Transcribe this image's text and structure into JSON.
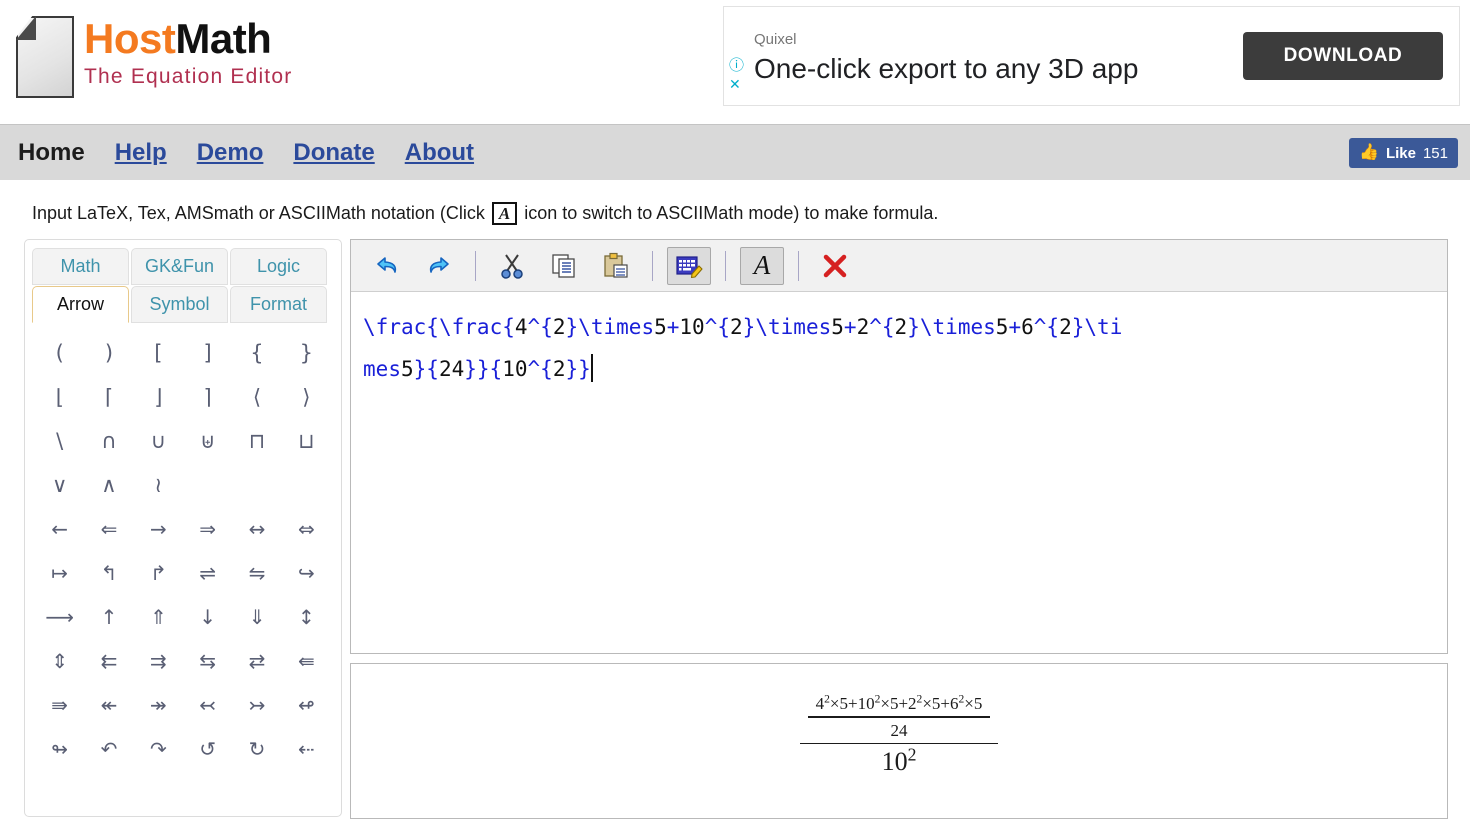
{
  "site": {
    "logo_primary": "Host",
    "logo_secondary": "Math",
    "tagline": "The Equation Editor",
    "colors": {
      "orange": "#f47a20",
      "black": "#111111",
      "maroon": "#b03050",
      "link": "#2b4a9b",
      "fb_blue": "#3b5998"
    }
  },
  "ad": {
    "brand": "Quixel",
    "headline": "One-click export to any 3D app",
    "cta_label": "DOWNLOAD",
    "info_icon": "info-icon",
    "close_icon": "close-icon"
  },
  "nav": {
    "items": [
      {
        "label": "Home",
        "current": true
      },
      {
        "label": "Help",
        "current": false
      },
      {
        "label": "Demo",
        "current": false
      },
      {
        "label": "Donate",
        "current": false
      },
      {
        "label": "About",
        "current": false
      }
    ],
    "like": {
      "label": "Like",
      "count": "151",
      "icon": "thumbs-up-icon"
    }
  },
  "instruction": {
    "before": "Input LaTeX, Tex, AMSmath or ASCIIMath notation (Click",
    "icon_letter": "A",
    "after": "icon to switch to ASCIIMath mode) to make formula."
  },
  "symbol_panel": {
    "tabs": [
      {
        "label": "Math",
        "active": false
      },
      {
        "label": "GK&Fun",
        "active": false
      },
      {
        "label": "Logic",
        "active": false
      },
      {
        "label": "Arrow",
        "active": true
      },
      {
        "label": "Symbol",
        "active": false
      },
      {
        "label": "Format",
        "active": false
      }
    ],
    "symbols": [
      "(",
      ")",
      "[",
      "]",
      "{",
      "}",
      "⌊",
      "⌈",
      "⌋",
      "⌉",
      "⟨",
      "⟩",
      "\\",
      "∩",
      "∪",
      "⊎",
      "⊓",
      "⊔",
      "∨",
      "∧",
      "≀",
      "",
      "",
      "",
      "←",
      "⇐",
      "→",
      "⇒",
      "↔",
      "⇔",
      "↦",
      "↰",
      "↱",
      "⇌",
      "⇋",
      "↪",
      "⟶",
      "↑",
      "⇑",
      "↓",
      "⇓",
      "↕",
      "⇕",
      "⇇",
      "⇉",
      "⇆",
      "⇄",
      "⇚",
      "⇛",
      "↞",
      "↠",
      "↢",
      "↣",
      "↫",
      "↬",
      "↶",
      "↷",
      "↺",
      "↻",
      "⇠"
    ]
  },
  "toolbar": {
    "buttons": [
      {
        "name": "undo-button",
        "icon": "undo-icon",
        "pressed": false
      },
      {
        "name": "redo-button",
        "icon": "redo-icon",
        "pressed": false
      },
      {
        "name": "cut-button",
        "icon": "scissors-icon",
        "pressed": false
      },
      {
        "name": "copy-button",
        "icon": "copy-icon",
        "pressed": false
      },
      {
        "name": "paste-button",
        "icon": "clipboard-icon",
        "pressed": false
      },
      {
        "name": "editor-mode-button",
        "icon": "keyboard-pencil-icon",
        "pressed": true
      },
      {
        "name": "asciimath-toggle-button",
        "icon": "letter-a-icon",
        "pressed": true
      },
      {
        "name": "clear-button",
        "icon": "red-x-icon",
        "pressed": false
      }
    ],
    "a_label": "A",
    "x_label": "✖"
  },
  "editor": {
    "latex_source": "\\frac{\\frac{4^{2}\\times5+10^{2}\\times5+2^{2}\\times5+6^{2}\\times5}{24}}{10^{2}}",
    "line1": "\\frac{\\frac{4^{2}\\times5+10^{2}\\times5+2^{2}\\times5+6^{2}\\ti",
    "line2": "mes5}{24}}{10^{2}}"
  },
  "preview": {
    "outer_numerator_inner_numerator": "4²×5+10²×5+2²×5+6²×5",
    "outer_numerator_inner_denominator": "24",
    "outer_denominator": "10²",
    "terms": [
      {
        "base": "4",
        "exp": "2",
        "factor": "5"
      },
      {
        "base": "10",
        "exp": "2",
        "factor": "5"
      },
      {
        "base": "2",
        "exp": "2",
        "factor": "5"
      },
      {
        "base": "6",
        "exp": "2",
        "factor": "5"
      }
    ],
    "inner_denominator_value": "24",
    "outer_denominator_base": "10",
    "outer_denominator_exp": "2",
    "times_symbol": "×",
    "plus_symbol": "+"
  }
}
